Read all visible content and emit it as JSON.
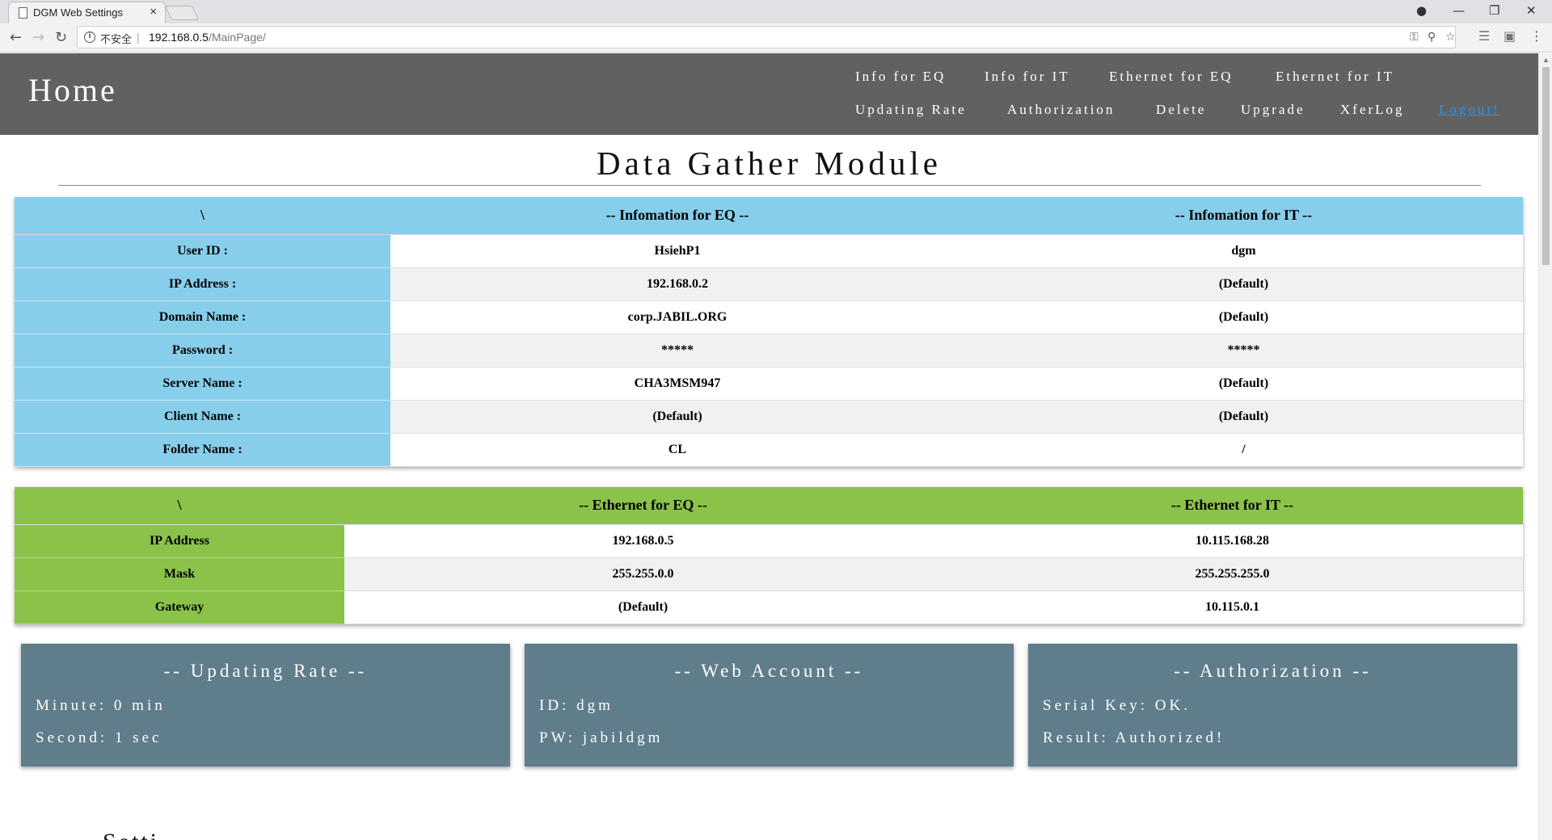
{
  "browser": {
    "tab_title": "DGM Web Settings",
    "tab_close": "×",
    "security_label": "不安全",
    "url_host": "192.168.0.5",
    "url_path": "/MainPage/"
  },
  "header": {
    "home": "Home",
    "menu": {
      "info_eq": "Info for EQ",
      "info_it": "Info for IT",
      "eth_eq": "Ethernet for EQ",
      "eth_it": "Ethernet for IT",
      "updating_rate": "Updating Rate",
      "authorization": "Authorization",
      "delete": "Delete",
      "upgrade": "Upgrade",
      "xferlog": "XferLog",
      "logout": "Logout!"
    }
  },
  "page_title": "Data Gather Module",
  "info_table": {
    "headers": [
      "\\",
      "-- Infomation for EQ --",
      "-- Infomation for IT --"
    ],
    "rows": [
      {
        "label": "User ID :",
        "eq": "HsiehP1",
        "it": "dgm"
      },
      {
        "label": "IP Address :",
        "eq": "192.168.0.2",
        "it": "(Default)"
      },
      {
        "label": "Domain Name :",
        "eq": "corp.JABIL.ORG",
        "it": "(Default)"
      },
      {
        "label": "Password :",
        "eq": "*****",
        "it": "*****"
      },
      {
        "label": "Server Name :",
        "eq": "CHA3MSM947",
        "it": "(Default)"
      },
      {
        "label": "Client Name :",
        "eq": "(Default)",
        "it": "(Default)"
      },
      {
        "label": "Folder Name :",
        "eq": "CL",
        "it": "/"
      }
    ]
  },
  "ethernet_table": {
    "headers": [
      "\\",
      "-- Ethernet for EQ --",
      "-- Ethernet for IT --"
    ],
    "rows": [
      {
        "label": "IP Address",
        "eq": "192.168.0.5",
        "it": "10.115.168.28"
      },
      {
        "label": "Mask",
        "eq": "255.255.0.0",
        "it": "255.255.255.0"
      },
      {
        "label": "Gateway",
        "eq": "(Default)",
        "it": "10.115.0.1"
      }
    ]
  },
  "cards": {
    "updating_rate": {
      "title": "-- Updating Rate --",
      "line1": "Minute: 0 min",
      "line2": "Second: 1 sec"
    },
    "web_account": {
      "title": "-- Web Account --",
      "line1": "ID: dgm",
      "line2": "PW: jabildgm"
    },
    "authorization": {
      "title": "-- Authorization --",
      "line1": "Serial Key: OK.",
      "line2": "Result: Authorized!"
    }
  },
  "settings_partial": "Setti"
}
